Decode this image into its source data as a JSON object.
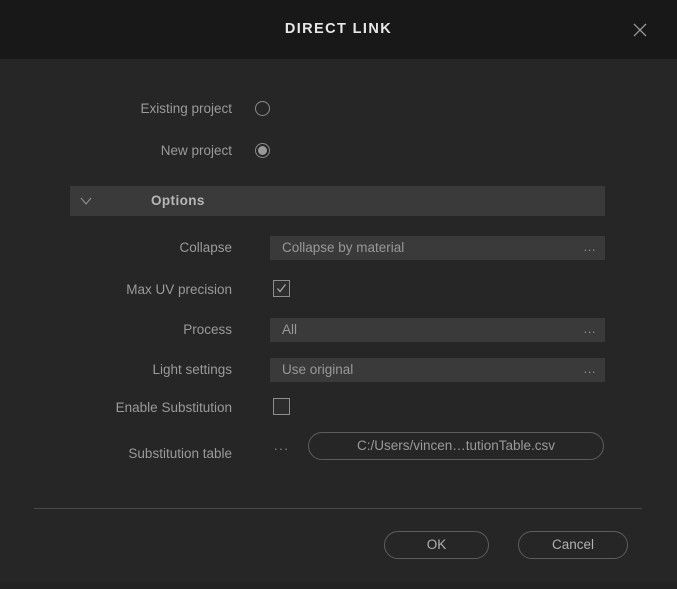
{
  "dialog": {
    "title": "DIRECT LINK",
    "close_icon": "close-icon"
  },
  "project_mode": {
    "options": [
      {
        "label": "Existing project",
        "selected": false
      },
      {
        "label": "New project",
        "selected": true
      }
    ]
  },
  "options_section": {
    "header_label": "Options",
    "expanded": true,
    "chevron_icon": "chevron-down-icon",
    "fields": [
      {
        "label": "Collapse",
        "type": "dropdown",
        "value": "Collapse by material",
        "more_glyph": "..."
      },
      {
        "label": "Max UV precision",
        "type": "checkbox",
        "checked": true
      },
      {
        "label": "Process",
        "type": "dropdown",
        "value": "All",
        "more_glyph": "..."
      },
      {
        "label": "Light settings",
        "type": "dropdown",
        "value": "Use original",
        "more_glyph": "..."
      },
      {
        "label": "Enable Substitution",
        "type": "checkbox",
        "checked": false
      }
    ],
    "substitution_table": {
      "label": "Substitution table",
      "browse_glyph": "...",
      "path": "C:/Users/vincen…tutionTable.csv"
    }
  },
  "footer": {
    "ok_label": "OK",
    "cancel_label": "Cancel"
  },
  "colors": {
    "dialog_background": "#262626",
    "titlebar_background": "#181818",
    "section_header_background": "#3a3a3a",
    "control_background": "#3a3a3a",
    "label_text": "#9a9a9a",
    "title_text": "#e8e8e8",
    "border": "#5d5d5d"
  }
}
